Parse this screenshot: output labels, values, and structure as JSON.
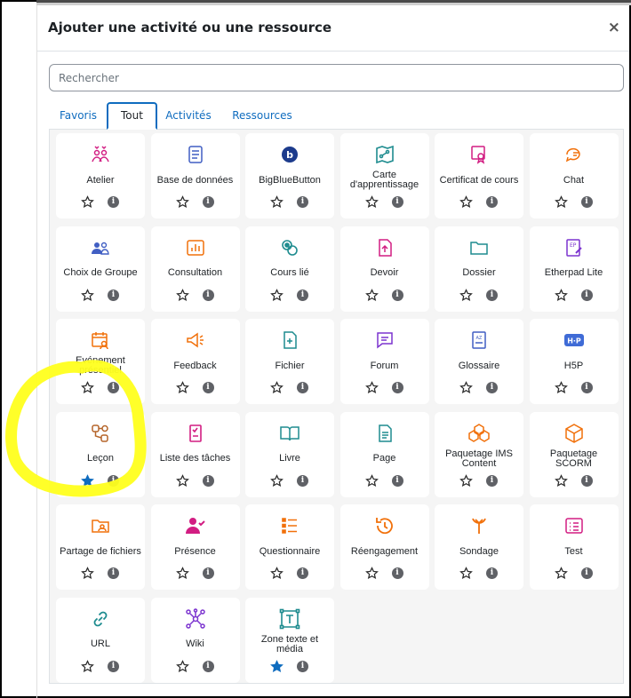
{
  "modal": {
    "title": "Ajouter une activité ou une ressource",
    "close_glyph": "×"
  },
  "search": {
    "placeholder": "Rechercher"
  },
  "tabs": [
    {
      "label": "Favoris",
      "active": false
    },
    {
      "label": "Tout",
      "active": true
    },
    {
      "label": "Activités",
      "active": false
    },
    {
      "label": "Ressources",
      "active": false
    }
  ],
  "colors": {
    "accent": "#0f6cbf",
    "pink": "#d21d82",
    "orange": "#f1700a",
    "teal": "#1e8c8f",
    "purple": "#7c34cf",
    "blue": "#415fc3",
    "navy": "#1c3b8c",
    "highlight": "#ffff1e"
  },
  "items": [
    {
      "name": "Atelier",
      "icon": "workshop-icon",
      "fav": false
    },
    {
      "name": "Base de données",
      "icon": "database-icon",
      "fav": false
    },
    {
      "name": "BigBlueButton",
      "icon": "bigbluebutton-icon",
      "fav": false
    },
    {
      "name": "Carte d'apprentissage",
      "icon": "learning-map-icon",
      "fav": false
    },
    {
      "name": "Certificat de cours",
      "icon": "certificate-icon",
      "fav": false
    },
    {
      "name": "Chat",
      "icon": "chat-icon",
      "fav": false
    },
    {
      "name": "Choix de Groupe",
      "icon": "group-choice-icon",
      "fav": false
    },
    {
      "name": "Consultation",
      "icon": "chart-icon",
      "fav": false
    },
    {
      "name": "Cours lié",
      "icon": "linked-course-icon",
      "fav": false
    },
    {
      "name": "Devoir",
      "icon": "assignment-icon",
      "fav": false
    },
    {
      "name": "Dossier",
      "icon": "folder-icon",
      "fav": false
    },
    {
      "name": "Etherpad Lite",
      "icon": "etherpad-icon",
      "fav": false
    },
    {
      "name": "Evénement présentiel",
      "icon": "event-icon",
      "fav": false
    },
    {
      "name": "Feedback",
      "icon": "megaphone-icon",
      "fav": false
    },
    {
      "name": "Fichier",
      "icon": "file-icon",
      "fav": false
    },
    {
      "name": "Forum",
      "icon": "forum-icon",
      "fav": false
    },
    {
      "name": "Glossaire",
      "icon": "glossary-icon",
      "fav": false
    },
    {
      "name": "H5P",
      "icon": "h5p-icon",
      "fav": false
    },
    {
      "name": "Leçon",
      "icon": "lesson-icon",
      "fav": true
    },
    {
      "name": "Liste des tâches",
      "icon": "checklist-icon",
      "fav": false
    },
    {
      "name": "Livre",
      "icon": "book-icon",
      "fav": false
    },
    {
      "name": "Page",
      "icon": "page-icon",
      "fav": false
    },
    {
      "name": "Paquetage IMS Content",
      "icon": "ims-package-icon",
      "fav": false
    },
    {
      "name": "Paquetage SCORM",
      "icon": "scorm-package-icon",
      "fav": false
    },
    {
      "name": "Partage de fichiers",
      "icon": "file-share-icon",
      "fav": false
    },
    {
      "name": "Présence",
      "icon": "attendance-icon",
      "fav": false
    },
    {
      "name": "Questionnaire",
      "icon": "questionnaire-icon",
      "fav": false
    },
    {
      "name": "Réengagement",
      "icon": "reengagement-icon",
      "fav": false
    },
    {
      "name": "Sondage",
      "icon": "poll-icon",
      "fav": false
    },
    {
      "name": "Test",
      "icon": "quiz-icon",
      "fav": false
    },
    {
      "name": "URL",
      "icon": "link-icon",
      "fav": false
    },
    {
      "name": "Wiki",
      "icon": "wiki-icon",
      "fav": false
    },
    {
      "name": "Zone texte et média",
      "icon": "text-media-icon",
      "fav": true
    }
  ],
  "info_glyph": "i"
}
